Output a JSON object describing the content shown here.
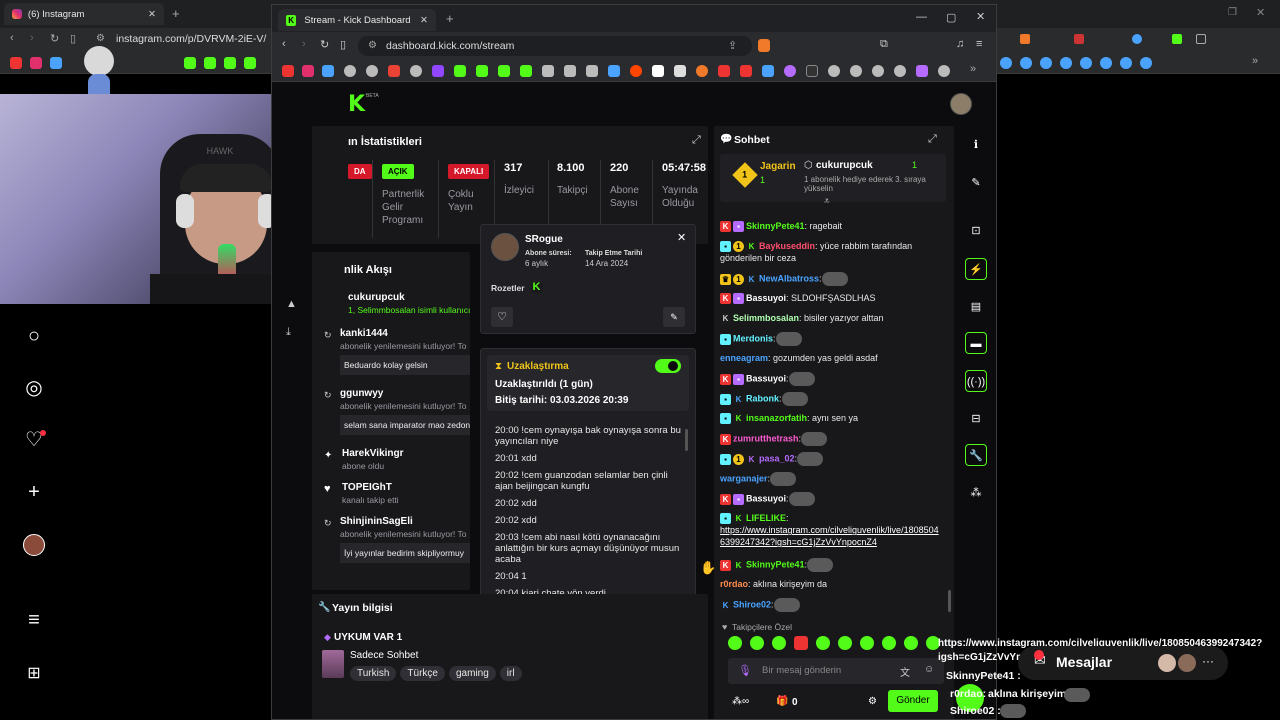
{
  "back_window": {
    "tab_title": "(6) Instagram",
    "url": "instagram.com/p/DVRVM-2iE-V/"
  },
  "front_window": {
    "tab_title": "Stream - Kick Dashboard",
    "url": "dashboard.kick.com/stream"
  },
  "kick": {
    "logo": "K",
    "logo_tag": "BETA"
  },
  "stats": {
    "title": "Yayın İstatistikleri",
    "title_visible": "ın İstatistikleri",
    "badge1": "DA",
    "badge_acik": "AÇIK",
    "partner_label": "Partnerlik Gelir Programı",
    "badge_kapali": "KAPALI",
    "coklu_label": "Çoklu Yayın",
    "viewers": "317",
    "viewers_label": "İzleyici",
    "followers": "8.100",
    "followers_label": "Takipçi",
    "subs": "220",
    "subs_label": "Abone Sayısı",
    "uptime": "05:47:58",
    "uptime_label": "Yayında Olduğu"
  },
  "feed": {
    "title_visible": "nlik Akışı",
    "items": [
      {
        "name": "cukurupcuk",
        "sub": "1, Selimmbosalan isimli kullanıcıy"
      },
      {
        "name": "kanki1444",
        "sub": "abonelik yenilemesini kutluyor! To",
        "msg": "Beduardo kolay gelsin"
      },
      {
        "name": "ggunwyy",
        "sub": "abonelik yenilemesini kutluyor! To",
        "msg": "selam sana imparator mao zedon"
      },
      {
        "name": "HarekVikingr",
        "sub": "abone oldu"
      },
      {
        "name": "TOPEIGhT",
        "sub": "kanalı takip etti"
      },
      {
        "name": "ShinjininSagEli",
        "sub": "abonelik yenilemesini kutluyor! To",
        "msg": "İyi yayınlar bedirim skipliyormuy"
      }
    ]
  },
  "popup": {
    "username": "SRogue",
    "sub_label": "Abone süresi:",
    "sub_value": "6 aylık",
    "follow_label": "Takip Etme Tarihi",
    "follow_value": "14 Ara 2024",
    "badges_label": "Rozetler",
    "timeout_title": "Uzaklaştırma",
    "timeout_status": "Uzaklaştırıldı (1 gün)",
    "timeout_end": "Bitiş tarihi: 03.03.2026 20:39",
    "log": [
      "20:00 !cem oynayışa bak oynayışa sonra bu yayıncıları niye",
      "20:01 xdd",
      "20:02 !cem guanzodan selamlar ben çinli ajan beijingcan kungfu",
      "20:02 xdd",
      "20:02 xdd",
      "20:03 !cem abi nasıl kötü oynanacağını anlattığın bir kurs açmayı düşünüyor musun acaba",
      "20:04 1",
      "20:04 kiari chate vön verdi"
    ]
  },
  "stream_info": {
    "title": "Yayın bilgisi",
    "stream_title": "UYKUM VAR 1",
    "category": "Sadece Sohbet",
    "tags": [
      "Turkish",
      "Türkçe",
      "gaming",
      "irl"
    ]
  },
  "chat": {
    "title": "Sohbet",
    "pinned_left_name": "Jagarin",
    "pinned_left_count": "1",
    "pinned_left_rank": "1",
    "pinned_user": "cukurupcuk",
    "pinned_count": "1",
    "pinned_sub": "1 abonelik hediye ederek 3. sıraya yükselin",
    "messages": [
      {
        "user": "SkinnyPete41",
        "color": "#53fc18",
        "text": ": ragebait"
      },
      {
        "user": "Baykuseddin",
        "color": "#ff4d6d",
        "text": ": yüce rabbim tarafından gönderilen bir ceza"
      },
      {
        "user": "NewAlbatross",
        "color": "#4aa3ff",
        "text": ":"
      },
      {
        "user": "Bassuyoi",
        "color": "#ffffff",
        "text": ": SLDOHFŞASDLHAS"
      },
      {
        "user": "Selimmbosalan",
        "color": "#b0ffb0",
        "text": ": bisiler yazıyor alttan"
      },
      {
        "user": "Merdonis",
        "color": "#62f2ff",
        "text": ":"
      },
      {
        "user": "enneagram",
        "color": "#4aa3ff",
        "text": ": gozumden yas geldi asdaf"
      },
      {
        "user": "Bassuyoi",
        "color": "#ffffff",
        "text": ":"
      },
      {
        "user": "Rabonk",
        "color": "#62f2ff",
        "text": ":"
      },
      {
        "user": "insanazorfatih",
        "color": "#53fc18",
        "text": ": aynı sen ya"
      },
      {
        "user": "zumrutthetrash",
        "color": "#ff5ad0",
        "text": ":"
      },
      {
        "user": "pasa_02",
        "color": "#b56bff",
        "text": ":"
      },
      {
        "user": "warganajer",
        "color": "#4aa3ff",
        "text": ":"
      },
      {
        "user": "Bassuyoi",
        "color": "#ffffff",
        "text": ":"
      },
      {
        "user": "LIFELIKE",
        "color": "#53fc18",
        "text": ":"
      },
      {
        "user": "SkinnyPete41",
        "color": "#53fc18",
        "text": ":"
      },
      {
        "user": "r0rdao",
        "color": "#ff8a4a",
        "text": ": aklına kirişeyim da"
      },
      {
        "user": "Shiroe02",
        "color": "#4aa3ff",
        "text": ":"
      }
    ],
    "link": "https://www.instagram.com/cilveliguvenlik/live/18085046399247342?igsh=cG1jZzVvYnpocnZ4",
    "followers_only": "Takipçilere Özel",
    "placeholder": "Bir mesaj gönderin",
    "send": "Gönder",
    "gift_count": "0"
  },
  "overlay": {
    "link_line1": "https://www.instagram.com/cilveliguvenlik/live/18085046399247342?",
    "link_line2": "igsh=cG1jZzVvYnpocnZ4",
    "messages_label": "Mesajlar",
    "o1_user": "SkinnyPete41 :",
    "o2_user": "r0rdao:",
    "o2_text": "aklına kirişeyim",
    "o3_user": "Shiroe02 :"
  },
  "colors": {
    "kick_green": "#53fc18",
    "bg": "#0c0c0e",
    "panel": "#18181b"
  }
}
